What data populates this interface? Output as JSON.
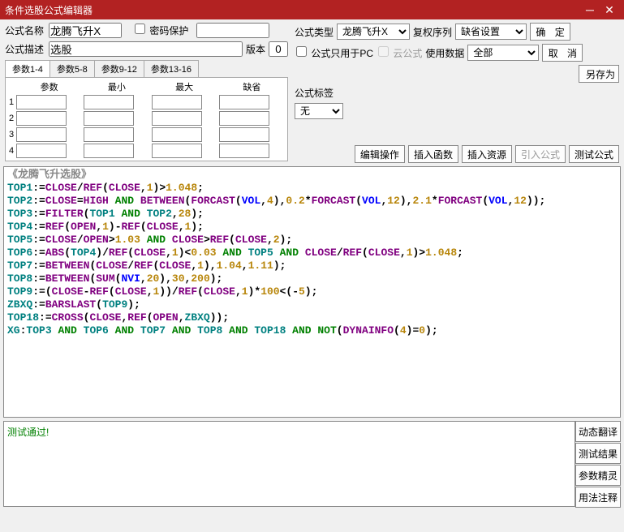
{
  "title": "条件选股公式编辑器",
  "labels": {
    "name": "公式名称",
    "pwd": "密码保护",
    "desc": "公式描述",
    "version": "版本",
    "type": "公式类型",
    "fq": "复权序列",
    "pconly": "公式只用于PC",
    "cloud": "云公式",
    "data": "使用数据",
    "tag": "公式标签"
  },
  "values": {
    "name": "龙腾飞升X",
    "desc": "选股",
    "version": "0",
    "type": "龙腾飞升X",
    "fq": "缺省设置",
    "data": "全部",
    "tag": "无"
  },
  "buttons": {
    "ok": "确 定",
    "cancel": "取 消",
    "saveas": "另存为",
    "editop": "编辑操作",
    "insfn": "插入函数",
    "insres": "插入资源",
    "import": "引入公式",
    "test": "测试公式",
    "dyntrans": "动态翻译",
    "testres": "测试结果",
    "paramwiz": "参数精灵",
    "usage": "用法注释"
  },
  "tabs": {
    "t1": "参数1-4",
    "t2": "参数5-8",
    "t3": "参数9-12",
    "t4": "参数13-16"
  },
  "paramHeaders": {
    "name": "参数",
    "min": "最小",
    "max": "最大",
    "def": "缺省"
  },
  "codeTitle": "《龙腾飞升选股》",
  "msg": "测试通过!",
  "code": [
    {
      "v": "TOP1",
      "op": ":=",
      "parts": [
        [
          "fn",
          "CLOSE"
        ],
        [
          "op",
          "/"
        ],
        [
          "fn",
          "REF"
        ],
        [
          "op",
          "("
        ],
        [
          "fn",
          "CLOSE"
        ],
        [
          "op",
          ","
        ],
        [
          "num",
          "1"
        ],
        [
          "op",
          ")>"
        ],
        [
          "num",
          "1.048"
        ],
        [
          "op",
          ";"
        ]
      ]
    },
    {
      "v": "TOP2",
      "op": ":=",
      "parts": [
        [
          "fn",
          "CLOSE"
        ],
        [
          "op",
          "="
        ],
        [
          "fn",
          "HIGH"
        ],
        [
          "kw",
          " AND "
        ],
        [
          "fn",
          "BETWEEN"
        ],
        [
          "op",
          "("
        ],
        [
          "fn",
          "FORCAST"
        ],
        [
          "op",
          "("
        ],
        [
          "vol",
          "VOL"
        ],
        [
          "op",
          ","
        ],
        [
          "num",
          "4"
        ],
        [
          "op",
          ")"
        ],
        [
          "op",
          ","
        ],
        [
          "num",
          "0.2"
        ],
        [
          "op",
          "*"
        ],
        [
          "fn",
          "FORCAST"
        ],
        [
          "op",
          "("
        ],
        [
          "vol",
          "VOL"
        ],
        [
          "op",
          ","
        ],
        [
          "num",
          "12"
        ],
        [
          "op",
          ")"
        ],
        [
          "op",
          ","
        ],
        [
          "num",
          "2.1"
        ],
        [
          "op",
          "*"
        ],
        [
          "fn",
          "FORCAST"
        ],
        [
          "op",
          "("
        ],
        [
          "vol",
          "VOL"
        ],
        [
          "op",
          ","
        ],
        [
          "num",
          "12"
        ],
        [
          "op",
          "));"
        ]
      ]
    },
    {
      "v": "TOP3",
      "op": ":=",
      "parts": [
        [
          "fn",
          "FILTER"
        ],
        [
          "op",
          "("
        ],
        [
          "var",
          "TOP1"
        ],
        [
          "kw",
          " AND "
        ],
        [
          "var",
          "TOP2"
        ],
        [
          "op",
          ","
        ],
        [
          "num",
          "28"
        ],
        [
          "op",
          ");"
        ]
      ]
    },
    {
      "v": "TOP4",
      "op": ":=",
      "parts": [
        [
          "fn",
          "REF"
        ],
        [
          "op",
          "("
        ],
        [
          "fn",
          "OPEN"
        ],
        [
          "op",
          ","
        ],
        [
          "num",
          "1"
        ],
        [
          "op",
          ")-"
        ],
        [
          "fn",
          "REF"
        ],
        [
          "op",
          "("
        ],
        [
          "fn",
          "CLOSE"
        ],
        [
          "op",
          ","
        ],
        [
          "num",
          "1"
        ],
        [
          "op",
          ");"
        ]
      ]
    },
    {
      "v": "TOP5",
      "op": ":=",
      "parts": [
        [
          "fn",
          "CLOSE"
        ],
        [
          "op",
          "/"
        ],
        [
          "fn",
          "OPEN"
        ],
        [
          "op",
          ">"
        ],
        [
          "num",
          "1.03"
        ],
        [
          "kw",
          " AND "
        ],
        [
          "fn",
          "CLOSE"
        ],
        [
          "op",
          ">"
        ],
        [
          "fn",
          "REF"
        ],
        [
          "op",
          "("
        ],
        [
          "fn",
          "CLOSE"
        ],
        [
          "op",
          ","
        ],
        [
          "num",
          "2"
        ],
        [
          "op",
          ");"
        ]
      ]
    },
    {
      "v": "TOP6",
      "op": ":=",
      "parts": [
        [
          "fn",
          "ABS"
        ],
        [
          "op",
          "("
        ],
        [
          "var",
          "TOP4"
        ],
        [
          "op",
          ")/"
        ],
        [
          "fn",
          "REF"
        ],
        [
          "op",
          "("
        ],
        [
          "fn",
          "CLOSE"
        ],
        [
          "op",
          ","
        ],
        [
          "num",
          "1"
        ],
        [
          "op",
          ")<"
        ],
        [
          "num",
          "0.03"
        ],
        [
          "kw",
          " AND "
        ],
        [
          "var",
          "TOP5"
        ],
        [
          "kw",
          " AND "
        ],
        [
          "fn",
          "CLOSE"
        ],
        [
          "op",
          "/"
        ],
        [
          "fn",
          "REF"
        ],
        [
          "op",
          "("
        ],
        [
          "fn",
          "CLOSE"
        ],
        [
          "op",
          ","
        ],
        [
          "num",
          "1"
        ],
        [
          "op",
          ")>"
        ],
        [
          "num",
          "1.048"
        ],
        [
          "op",
          ";"
        ]
      ]
    },
    {
      "v": "TOP7",
      "op": ":=",
      "parts": [
        [
          "fn",
          "BETWEEN"
        ],
        [
          "op",
          "("
        ],
        [
          "fn",
          "CLOSE"
        ],
        [
          "op",
          "/"
        ],
        [
          "fn",
          "REF"
        ],
        [
          "op",
          "("
        ],
        [
          "fn",
          "CLOSE"
        ],
        [
          "op",
          ","
        ],
        [
          "num",
          "1"
        ],
        [
          "op",
          ")"
        ],
        [
          "op",
          ","
        ],
        [
          "num",
          "1.04"
        ],
        [
          "op",
          ","
        ],
        [
          "num",
          "1.11"
        ],
        [
          "op",
          ");"
        ]
      ]
    },
    {
      "v": "TOP8",
      "op": ":=",
      "parts": [
        [
          "fn",
          "BETWEEN"
        ],
        [
          "op",
          "("
        ],
        [
          "fn",
          "SUM"
        ],
        [
          "op",
          "("
        ],
        [
          "vol",
          "NVI"
        ],
        [
          "op",
          ","
        ],
        [
          "num",
          "20"
        ],
        [
          "op",
          ")"
        ],
        [
          "op",
          ","
        ],
        [
          "num",
          "30"
        ],
        [
          "op",
          ","
        ],
        [
          "num",
          "200"
        ],
        [
          "op",
          ");"
        ]
      ]
    },
    {
      "v": "TOP9",
      "op": ":=",
      "parts": [
        [
          "op",
          "("
        ],
        [
          "fn",
          "CLOSE"
        ],
        [
          "op",
          "-"
        ],
        [
          "fn",
          "REF"
        ],
        [
          "op",
          "("
        ],
        [
          "fn",
          "CLOSE"
        ],
        [
          "op",
          ","
        ],
        [
          "num",
          "1"
        ],
        [
          "op",
          "))/"
        ],
        [
          "fn",
          "REF"
        ],
        [
          "op",
          "("
        ],
        [
          "fn",
          "CLOSE"
        ],
        [
          "op",
          ","
        ],
        [
          "num",
          "1"
        ],
        [
          "op",
          ")*"
        ],
        [
          "num",
          "100"
        ],
        [
          "op",
          "<(-"
        ],
        [
          "num",
          "5"
        ],
        [
          "op",
          ");"
        ]
      ]
    },
    {
      "v": "ZBXQ",
      "op": ":=",
      "parts": [
        [
          "fn",
          "BARSLAST"
        ],
        [
          "op",
          "("
        ],
        [
          "var",
          "TOP9"
        ],
        [
          "op",
          ");"
        ]
      ]
    },
    {
      "v": "TOP18",
      "op": ":=",
      "parts": [
        [
          "fn",
          "CROSS"
        ],
        [
          "op",
          "("
        ],
        [
          "fn",
          "CLOSE"
        ],
        [
          "op",
          ","
        ],
        [
          "fn",
          "REF"
        ],
        [
          "op",
          "("
        ],
        [
          "fn",
          "OPEN"
        ],
        [
          "op",
          ","
        ],
        [
          "var",
          "ZBXQ"
        ],
        [
          "op",
          "));"
        ]
      ]
    },
    {
      "v": "XG",
      "op": ":",
      "parts": [
        [
          "var",
          "TOP3"
        ],
        [
          "kw",
          " AND "
        ],
        [
          "var",
          "TOP6"
        ],
        [
          "kw",
          " AND "
        ],
        [
          "var",
          "TOP7"
        ],
        [
          "kw",
          " AND "
        ],
        [
          "var",
          "TOP8"
        ],
        [
          "kw",
          " AND "
        ],
        [
          "var",
          "TOP18"
        ],
        [
          "kw",
          " AND NOT"
        ],
        [
          "op",
          "("
        ],
        [
          "fn",
          "DYNAINFO"
        ],
        [
          "op",
          "("
        ],
        [
          "num",
          "4"
        ],
        [
          "op",
          ")="
        ],
        [
          "num",
          "0"
        ],
        [
          "op",
          ");"
        ]
      ]
    }
  ]
}
